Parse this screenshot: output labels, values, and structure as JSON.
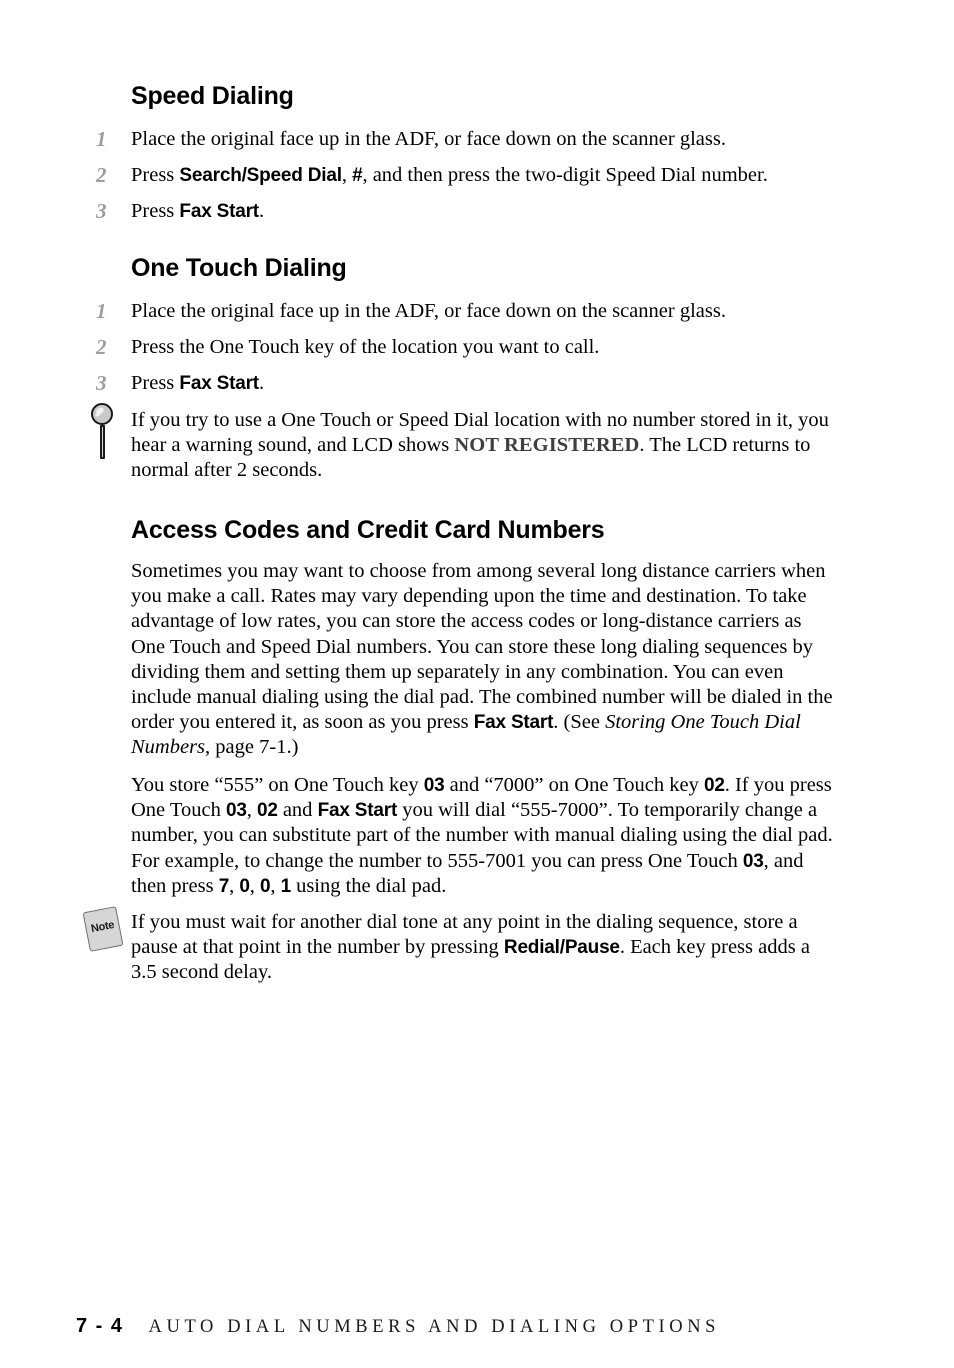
{
  "document": {
    "page_label": "7 - 4",
    "footer_title": "AUTO DIAL NUMBERS AND DIALING OPTIONS"
  },
  "sections": {
    "speed_dialing": {
      "heading": "Speed Dialing",
      "steps": [
        {
          "number": "1",
          "text": "Place the original face up in the ADF, or face down on the scanner glass."
        },
        {
          "number": "2",
          "text_before": "Press ",
          "bold_1": "Search/Speed Dial",
          "text_mid": ", ",
          "bold_2": "#",
          "text_after": ", and then press the two-digit Speed Dial number."
        },
        {
          "number": "3",
          "text_before": "Press ",
          "bold_1": "Fax Start",
          "text_after": "."
        }
      ]
    },
    "one_touch_dialing": {
      "heading": "One Touch Dialing",
      "steps": [
        {
          "number": "1",
          "text": "Place the original face up in the ADF, or face down on the scanner glass."
        },
        {
          "number": "2",
          "text": "Press the One Touch key of the location you want to call."
        },
        {
          "number": "3",
          "text_before": "Press ",
          "bold_1": "Fax Start",
          "text_after": "."
        }
      ],
      "tip": {
        "icon": "magnifier-icon",
        "text_before": "If you try to use a One Touch or Speed Dial location with no number stored in it, you hear a warning sound, and LCD shows ",
        "lcd_value": "NOT REGISTERED",
        "text_after": ". The LCD returns to normal after 2 seconds."
      }
    },
    "access_codes": {
      "heading": "Access Codes and Credit Card Numbers",
      "paragraph_1": {
        "part_1": "Sometimes you may want to choose from among several long distance carriers when you make a call.  Rates may vary depending upon the time and destination.  To take advantage of low rates, you can store the access codes or long-distance carriers as One Touch and Speed Dial numbers. You can store these long dialing sequences by dividing them and setting them up separately in any combination.  You can even include manual dialing using the dial pad.  The combined number will be dialed in the order you entered it, as soon as you press ",
        "bold_1": "Fax Start",
        "part_2": ".  (See ",
        "italic_1": "Storing One Touch Dial Numbers",
        "part_3": ", page 7-1.)"
      },
      "paragraph_2": {
        "part_1": "You store “555” on One Touch key ",
        "bold_1": "03",
        "part_2": " and “7000” on One Touch key ",
        "bold_2": "02",
        "part_3": ".  If you press One Touch ",
        "bold_3": "03",
        "part_4": ", ",
        "bold_4": "02",
        "part_5": " and ",
        "bold_5": "Fax Start",
        "part_6": " you will dial “555-7000”.  To temporarily change a number, you can substitute part of the number with manual dialing using the dial pad.  For example, to change the number to 555-7001 you can press One Touch ",
        "bold_6": "03",
        "part_7": ", and then press ",
        "bold_7": "7",
        "part_8": ", ",
        "bold_8": "0",
        "part_9": ", ",
        "bold_9": "0",
        "part_10": ", ",
        "bold_10": "1",
        "part_11": " using the dial pad."
      },
      "note": {
        "icon": "note-icon",
        "icon_label": "Note",
        "text_before": "If you must wait for another dial tone at any point in the dialing sequence, store a pause at that point in the number by pressing ",
        "bold_1": "Redial/Pause",
        "text_after": ". Each key press adds a 3.5 second delay."
      }
    }
  },
  "colors": {
    "step_number": "#9d9d9d",
    "lcd_text": "#3f3f3f",
    "body_text": "#000000",
    "note_icon_fill": "#d6d6d6"
  }
}
